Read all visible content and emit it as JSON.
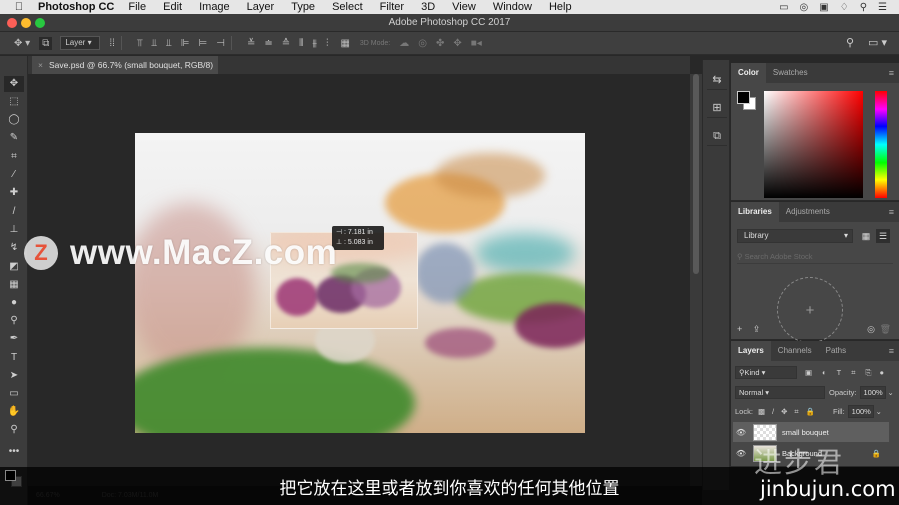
{
  "menubar": {
    "app_name": "Photoshop CC",
    "items": [
      "File",
      "Edit",
      "Image",
      "Layer",
      "Type",
      "Select",
      "Filter",
      "3D",
      "View",
      "Window",
      "Help"
    ],
    "status_icons": [
      "display-icon",
      "creative-cloud-icon",
      "screen-record-icon",
      "dropbox-icon",
      "spotlight-search-icon",
      "notification-list-icon"
    ]
  },
  "window": {
    "title": "Adobe Photoshop CC 2017",
    "traffic_colors": {
      "close": "#fc5f57",
      "minimize": "#fdbc2e",
      "zoom": "#28c840"
    }
  },
  "options_bar": {
    "auto_select_value": "Layer",
    "mode_3d_label": "3D Mode:"
  },
  "document": {
    "tab_title": "Save.psd @ 66.7% (small bouquet, RGB/8)",
    "close_glyph": "×"
  },
  "transform_readout": {
    "width": "⊣ : 7.181 in",
    "height": "⊥ : 5.083 in"
  },
  "tools": [
    {
      "name": "move-tool",
      "glyph": "✥"
    },
    {
      "name": "marquee-tool",
      "glyph": "⬚"
    },
    {
      "name": "lasso-tool",
      "glyph": "◯"
    },
    {
      "name": "quick-selection-tool",
      "glyph": "✎"
    },
    {
      "name": "crop-tool",
      "glyph": "⌗"
    },
    {
      "name": "eyedropper-tool",
      "glyph": "⁄"
    },
    {
      "name": "healing-brush-tool",
      "glyph": "✚"
    },
    {
      "name": "brush-tool",
      "glyph": "/"
    },
    {
      "name": "clone-stamp-tool",
      "glyph": "⊥"
    },
    {
      "name": "history-brush-tool",
      "glyph": "↯"
    },
    {
      "name": "eraser-tool",
      "glyph": "◩"
    },
    {
      "name": "gradient-tool",
      "glyph": "▦"
    },
    {
      "name": "blur-tool",
      "glyph": "●"
    },
    {
      "name": "dodge-tool",
      "glyph": "⚲"
    },
    {
      "name": "pen-tool",
      "glyph": "✒"
    },
    {
      "name": "type-tool",
      "glyph": "T"
    },
    {
      "name": "path-selection-tool",
      "glyph": "➤"
    },
    {
      "name": "rectangle-tool",
      "glyph": "▭"
    },
    {
      "name": "hand-tool",
      "glyph": "✋"
    },
    {
      "name": "zoom-tool",
      "glyph": "⚲"
    },
    {
      "name": "more-tools",
      "glyph": "•••"
    }
  ],
  "color_panel": {
    "tabs": [
      "Color",
      "Swatches"
    ],
    "foreground": "#000000",
    "background": "#ffffff",
    "hue_color": "#ff0000"
  },
  "libraries_panel": {
    "tabs": [
      "Libraries",
      "Adjustments"
    ],
    "library_value": "Library",
    "search_placeholder": "Search Adobe Stock",
    "add_glyph": "+"
  },
  "layers_panel": {
    "tabs": [
      "Layers",
      "Channels",
      "Paths"
    ],
    "filter_value": "Kind",
    "blend_mode": "Normal",
    "opacity_label": "Opacity:",
    "opacity_value": "100%",
    "lock_label": "Lock:",
    "fill_label": "Fill:",
    "fill_value": "100%",
    "layers": [
      {
        "name": "small bouquet",
        "visible": true,
        "selected": true,
        "locked": false
      },
      {
        "name": "Background",
        "visible": true,
        "selected": false,
        "locked": true
      }
    ]
  },
  "status_bar": {
    "zoom": "66.67%",
    "doc_info": "Doc: 7.03M/11.0M"
  },
  "overlays": {
    "watermark_logo": "Z",
    "watermark_text": "www.MacZ.com",
    "subtitle": "把它放在这里或者放到你喜欢的任何其他位置",
    "corner_watermark_cn": "进步君",
    "corner_watermark_en": "jinbujun.com"
  }
}
